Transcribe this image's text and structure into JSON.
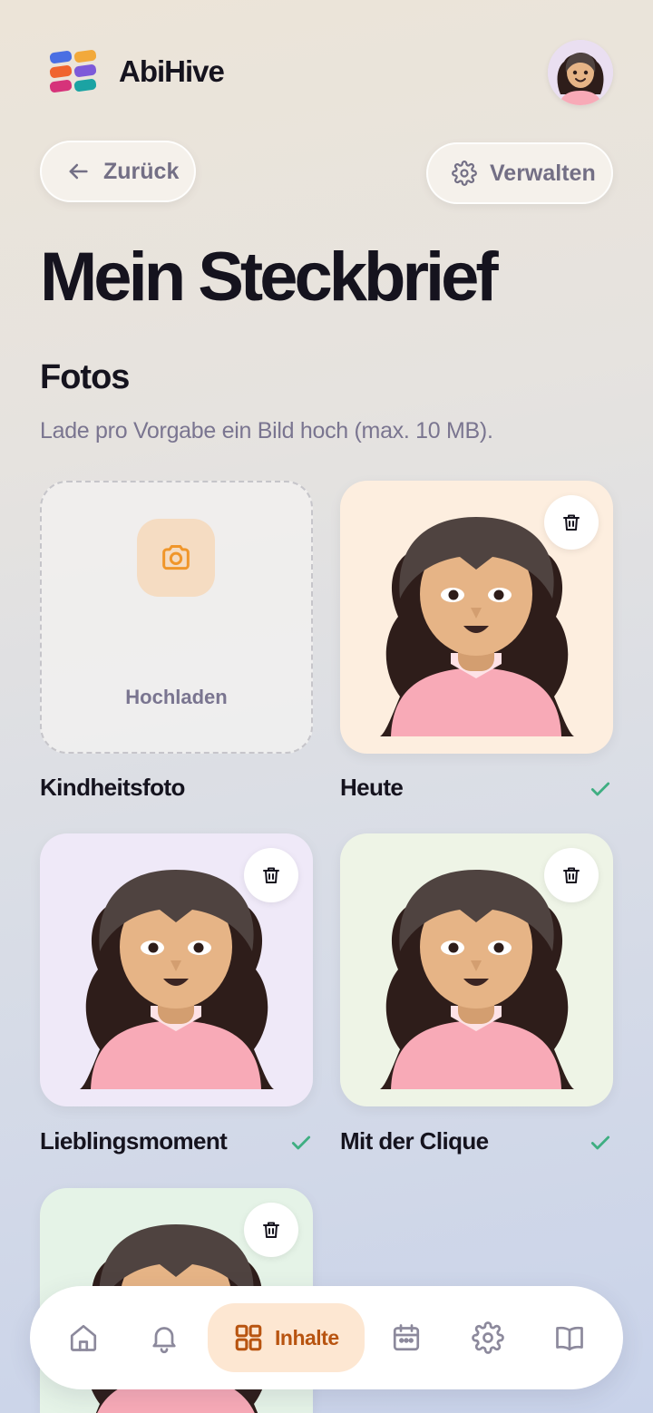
{
  "app": {
    "name": "AbiHive"
  },
  "header": {
    "back_label": "Zurück",
    "manage_label": "Verwalten"
  },
  "page": {
    "title": "Mein Steckbrief"
  },
  "photos": {
    "section_title": "Fotos",
    "subtitle": "Lade pro Vorgabe ein Bild hoch (max. 10 MB).",
    "upload_label": "Hochladen",
    "items": [
      {
        "label": "Kindheitsfoto",
        "uploaded": false
      },
      {
        "label": "Heute",
        "uploaded": true,
        "bg": "#fdeedf"
      },
      {
        "label": "Lieblingsmoment",
        "uploaded": true,
        "bg": "#efe9f8"
      },
      {
        "label": "Mit der Clique",
        "uploaded": true,
        "bg": "#eef4e6"
      },
      {
        "label": "",
        "uploaded": true,
        "bg": "#e5f3e7"
      }
    ]
  },
  "nav": {
    "items": [
      {
        "icon": "home-icon"
      },
      {
        "icon": "bell-icon"
      },
      {
        "icon": "grid-icon",
        "label": "Inhalte",
        "active": true
      },
      {
        "icon": "calendar-icon"
      },
      {
        "icon": "gear-icon"
      },
      {
        "icon": "book-icon"
      }
    ]
  },
  "colors": {
    "accent": "#b85410",
    "accent_bg": "#fde7d2",
    "check": "#3fae82",
    "muted_text": "#7a7590"
  }
}
